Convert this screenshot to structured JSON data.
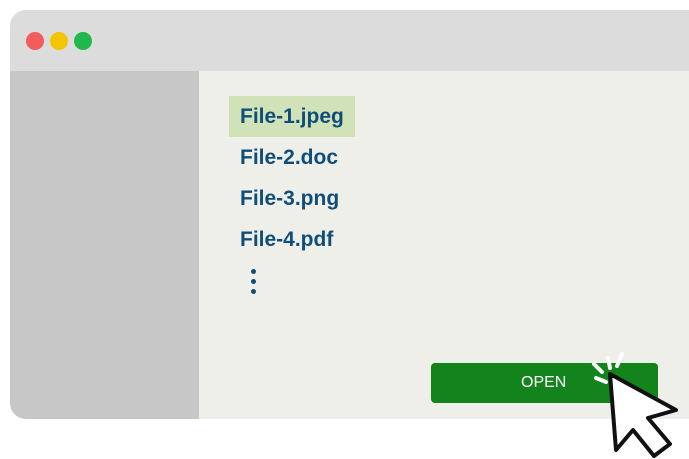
{
  "window": {
    "controls": [
      {
        "name": "close",
        "color": "#f25c5c"
      },
      {
        "name": "minimize",
        "color": "#f5c400"
      },
      {
        "name": "maximize",
        "color": "#20b84a"
      }
    ]
  },
  "file_list": {
    "items": [
      {
        "label": "File-1.jpeg",
        "selected": true
      },
      {
        "label": "File-2.doc",
        "selected": false
      },
      {
        "label": "File-3.png",
        "selected": false
      },
      {
        "label": "File-4.pdf",
        "selected": false
      }
    ],
    "more_icon": "vertical-ellipsis-icon"
  },
  "actions": {
    "open_label": "OPEN"
  },
  "cursor": {
    "icon": "mouse-pointer-click-icon"
  },
  "colors": {
    "accent": "#13831c",
    "file_text": "#0f4e78",
    "selection": "#d2e2b8",
    "sidebar": "#c7c7c7",
    "titlebar": "#dcdcdc",
    "content": "#efefea"
  }
}
